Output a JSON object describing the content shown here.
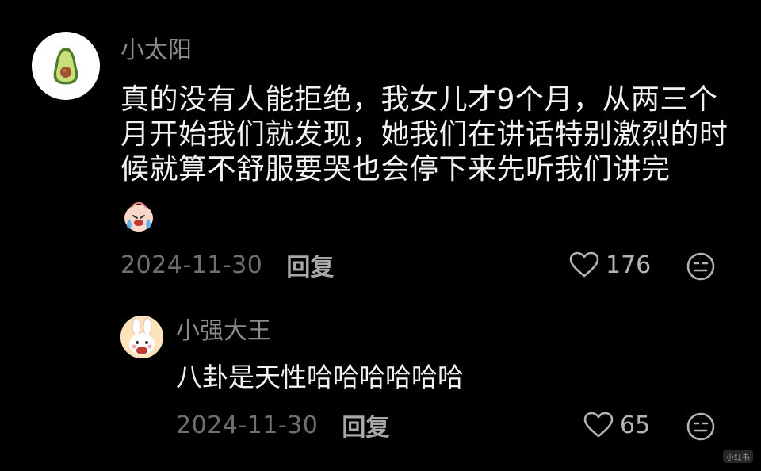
{
  "comment": {
    "author": "小太阳",
    "avatar_icon": "avocado-icon",
    "text": "真的没有人能拒绝，我女儿才9个月，从两三个月开始我们就发现，她我们在讲话特别激烈的时候就算不舒服要哭也会停下来先听我们讲完",
    "emoji_icon": "crying-face-emoji-icon",
    "date": "2024-11-30",
    "reply_label": "回复",
    "likes": "176",
    "like_icon": "heart-outline-icon",
    "more_icon": "neutral-face-icon"
  },
  "reply": {
    "author": "小强大王",
    "avatar_icon": "bunny-avatar-icon",
    "text": "八卦是天性哈哈哈哈哈哈",
    "date": "2024-11-30",
    "reply_label": "回复",
    "likes": "65",
    "like_icon": "heart-outline-icon",
    "more_icon": "neutral-face-icon"
  },
  "watermark": "小红书",
  "colors": {
    "background": "#000000",
    "text_primary": "#f2f2f2",
    "text_secondary": "#8a8a8a",
    "avocado_green": "#7cb342",
    "avocado_pit": "#a0522d"
  }
}
